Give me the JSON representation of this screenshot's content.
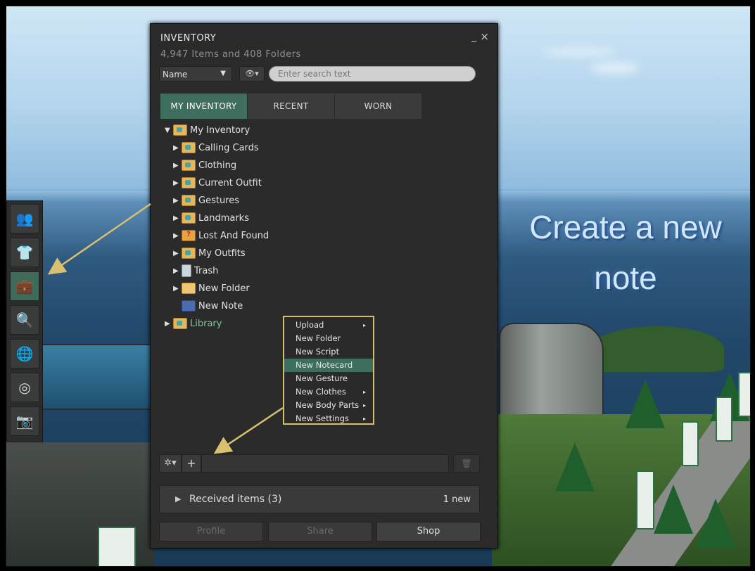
{
  "window": {
    "title": "INVENTORY",
    "minimize_glyph": "_",
    "close_glyph": "×",
    "item_count": "4,947 Items and 408 Folders"
  },
  "filter": {
    "sort_value": "Name",
    "search_placeholder": "Enter search text"
  },
  "tabs": [
    {
      "label": "MY INVENTORY",
      "active": true
    },
    {
      "label": "RECENT",
      "active": false
    },
    {
      "label": "WORN",
      "active": false
    }
  ],
  "tree": {
    "root": "My Inventory",
    "children": [
      {
        "label": "Calling Cards",
        "icon": "folder-icon"
      },
      {
        "label": "Clothing",
        "icon": "folder-icon"
      },
      {
        "label": "Current Outfit",
        "icon": "folder-icon"
      },
      {
        "label": "Gestures",
        "icon": "folder-icon"
      },
      {
        "label": "Landmarks",
        "icon": "folder-icon"
      },
      {
        "label": "Lost And Found",
        "icon": "lost-and-found-icon"
      },
      {
        "label": "My Outfits",
        "icon": "folder-icon"
      },
      {
        "label": "Trash",
        "icon": "trash-icon"
      },
      {
        "label": "New Folder",
        "icon": "folder-icon"
      },
      {
        "label": "New Note",
        "icon": "notecard-icon"
      }
    ],
    "library": "Library"
  },
  "context_menu": {
    "items": [
      {
        "label": "Upload",
        "submenu": true
      },
      {
        "label": "New Folder",
        "submenu": false
      },
      {
        "label": "New Script",
        "submenu": false
      },
      {
        "label": "New Notecard",
        "submenu": false,
        "highlighted": true
      },
      {
        "label": "New Gesture",
        "submenu": false
      },
      {
        "label": "New Clothes",
        "submenu": true
      },
      {
        "label": "New Body Parts",
        "submenu": true
      },
      {
        "label": "New Settings",
        "submenu": true
      }
    ],
    "submenu_glyph": "▸"
  },
  "bottom_bar": {
    "gear_glyph": "✲▾",
    "plus_glyph": "+",
    "trash_glyph": "🗑"
  },
  "received": {
    "label": "Received items (3)",
    "new_count": "1 new"
  },
  "actions": [
    {
      "label": "Profile",
      "enabled": false
    },
    {
      "label": "Share",
      "enabled": false
    },
    {
      "label": "Shop",
      "enabled": true
    }
  ],
  "annotation": {
    "text_line1": "Create a new",
    "text_line2": "note",
    "arrow_color": "#d9c070"
  },
  "dock": {
    "buttons": [
      {
        "icon": "people-icon",
        "glyph": "👥"
      },
      {
        "icon": "appearance-shirt-icon",
        "glyph": "👕"
      },
      {
        "icon": "inventory-bag-icon",
        "glyph": "💼",
        "active": true
      },
      {
        "icon": "search-icon",
        "glyph": "🔍"
      },
      {
        "icon": "map-icon",
        "glyph": "🌐"
      },
      {
        "icon": "voice-icon",
        "glyph": "◎"
      },
      {
        "icon": "snapshot-camera-icon",
        "glyph": "📷"
      }
    ]
  },
  "colors": {
    "accent": "#3e6f5e",
    "panel_bg": "#2b2b2b",
    "highlight_border": "#d6c067",
    "library_text": "#7ec893"
  }
}
